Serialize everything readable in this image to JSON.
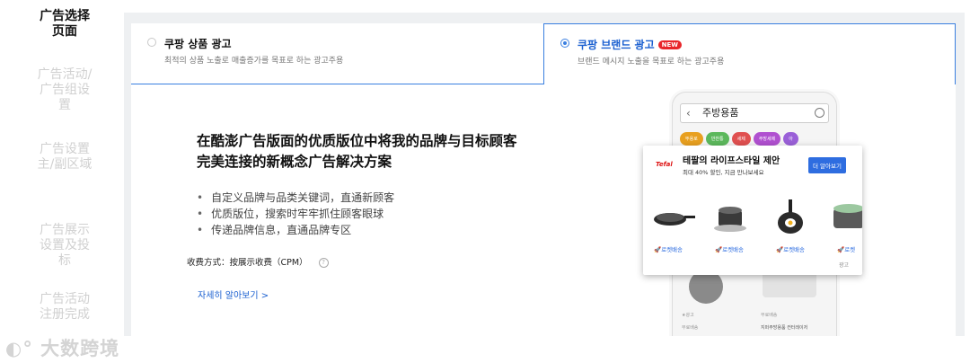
{
  "sidebar": {
    "steps": [
      {
        "label": "广告选择\n页面",
        "active": true
      },
      {
        "label": "广告活动/\n广告组设\n置",
        "active": false
      },
      {
        "label": "广告设置\n主/副区域",
        "active": false
      },
      {
        "label": "广告展示\n设置及投\n标",
        "active": false
      },
      {
        "label": "广告活动\n注册完成",
        "active": false
      }
    ]
  },
  "watermark": "大数跨境",
  "cards": [
    {
      "title": "쿠팡 상품 광고",
      "subtitle": "최적의 상품 노출로 매출증가를 목표로 하는 광고주용",
      "selected": false
    },
    {
      "title": "쿠팡 브랜드 광고",
      "badge": "NEW",
      "subtitle": "브랜드 메시지 노출을 목표로 하는 광고주용",
      "selected": true
    }
  ],
  "main": {
    "headline": "在酷澎广告版面的优质版位中将我的品牌与目标顾客完美连接的新概念广告解决方案",
    "bullets": [
      "自定义品牌与品类关键词，直通新顾客",
      "优质版位，搜索时牢牢抓住顾客眼球",
      "传递品牌信息，直通品牌专区"
    ],
    "billing": "收费方式：按展示收费（CPM）",
    "learn_more": "자세히 알아보기 >"
  },
  "phone": {
    "search_query": "주방용품",
    "chips": [
      "뚜용로",
      "반찬통",
      "세제",
      "주방세제",
      "아"
    ],
    "item_tags": [
      "★광고",
      "무료배송",
      "무료배송",
      "지퍼주방용품 컨터레이저"
    ]
  },
  "popup": {
    "brand": "Tefal",
    "title": "테팔의 라이프스타일 제안",
    "subtitle": "최대 40% 할인, 지금 만나보세요",
    "button": "더 알아보기",
    "delivery_labels": [
      "로켓배송",
      "로켓배송",
      "로켓배송",
      "로켓"
    ],
    "ad_label": "광고"
  },
  "colors": {
    "accent": "#1a5fd0",
    "badge": "#e8262a",
    "panel_bg": "#eef0f2"
  }
}
